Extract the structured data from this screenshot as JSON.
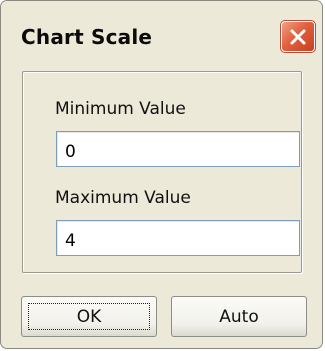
{
  "window": {
    "title": "Chart Scale",
    "close_icon": "close-icon"
  },
  "colors": {
    "dialog_background": "#ece9d8",
    "close_button": "#e0603f"
  },
  "form": {
    "minimum": {
      "label": "Minimum Value",
      "value": "0"
    },
    "maximum": {
      "label": "Maximum Value",
      "value": "4"
    }
  },
  "buttons": {
    "ok_label": "OK",
    "auto_label": "Auto"
  }
}
